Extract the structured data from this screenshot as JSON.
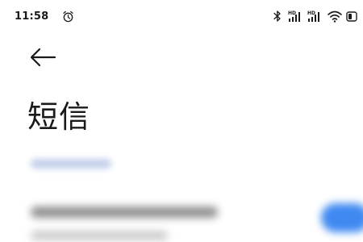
{
  "status_bar": {
    "time": "11:58",
    "icons": [
      "alarm-icon",
      "bluetooth-icon",
      "hd-signal-icon",
      "hd-signal-icon",
      "wifi-icon",
      "battery-icon"
    ],
    "hd_label": "HD"
  },
  "header": {
    "back_icon": "arrow-left-icon",
    "title": "短信"
  },
  "colors": {
    "accent": "#2b7df0",
    "text": "#1a1a1a",
    "background": "#ffffff"
  }
}
